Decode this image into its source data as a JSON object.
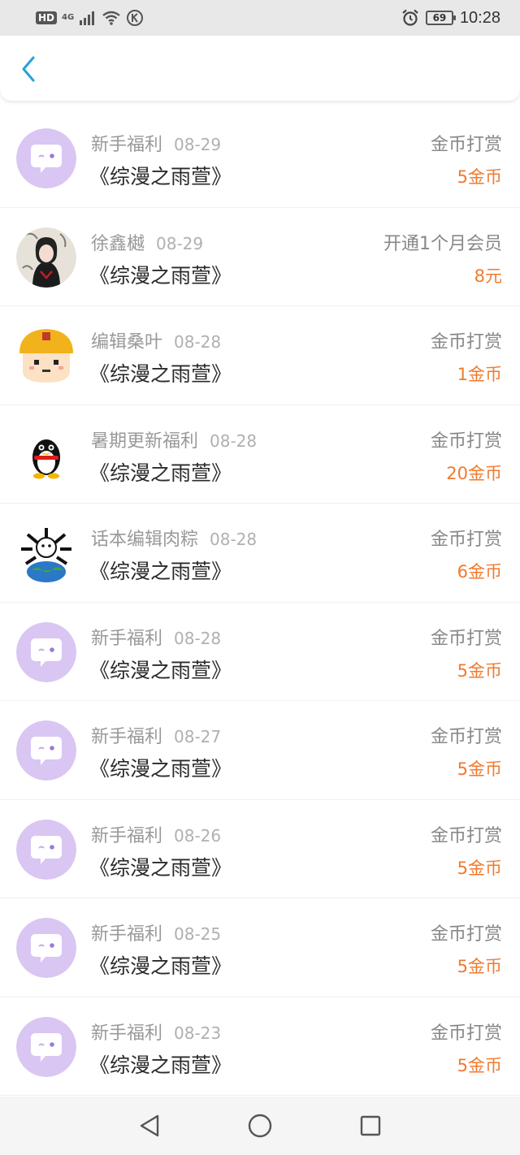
{
  "status_bar": {
    "hd": "HD",
    "network": "4G",
    "battery": "69",
    "time": "10:28",
    "icons": [
      "signal-icon",
      "wifi-icon",
      "k-icon",
      "alarm-icon"
    ]
  },
  "header": {
    "back_icon": "chevron-left-icon",
    "accent": "#2a9fd8"
  },
  "colors": {
    "amount": "#f07a2e",
    "welfare_avatar": "#d9c6f2"
  },
  "records": [
    {
      "name": "新手福利",
      "date": "08-29",
      "book": "《综漫之雨萱》",
      "type": "金币打赏",
      "amount": "5金币",
      "avatar": "chat-bubble-icon"
    },
    {
      "name": "徐鑫樾",
      "date": "08-29",
      "book": "《综漫之雨萱》",
      "type": "开通1个月会员",
      "amount": "8元",
      "avatar": "user-avatar"
    },
    {
      "name": "编辑桑叶",
      "date": "08-28",
      "book": "《综漫之雨萱》",
      "type": "金币打赏",
      "amount": "1金币",
      "avatar": "pixel-character-avatar"
    },
    {
      "name": "暑期更新福利",
      "date": "08-28",
      "book": "《综漫之雨萱》",
      "type": "金币打赏",
      "amount": "20金币",
      "avatar": "penguin-avatar"
    },
    {
      "name": "话本编辑肉粽",
      "date": "08-28",
      "book": "《综漫之雨萱》",
      "type": "金币打赏",
      "amount": "6金币",
      "avatar": "globe-avatar"
    },
    {
      "name": "新手福利",
      "date": "08-28",
      "book": "《综漫之雨萱》",
      "type": "金币打赏",
      "amount": "5金币",
      "avatar": "chat-bubble-icon"
    },
    {
      "name": "新手福利",
      "date": "08-27",
      "book": "《综漫之雨萱》",
      "type": "金币打赏",
      "amount": "5金币",
      "avatar": "chat-bubble-icon"
    },
    {
      "name": "新手福利",
      "date": "08-26",
      "book": "《综漫之雨萱》",
      "type": "金币打赏",
      "amount": "5金币",
      "avatar": "chat-bubble-icon"
    },
    {
      "name": "新手福利",
      "date": "08-25",
      "book": "《综漫之雨萱》",
      "type": "金币打赏",
      "amount": "5金币",
      "avatar": "chat-bubble-icon"
    },
    {
      "name": "新手福利",
      "date": "08-23",
      "book": "《综漫之雨萱》",
      "type": "金币打赏",
      "amount": "5金币",
      "avatar": "chat-bubble-icon"
    }
  ],
  "nav": {
    "back": "back-triangle-icon",
    "home": "home-circle-icon",
    "recents": "recents-square-icon"
  }
}
